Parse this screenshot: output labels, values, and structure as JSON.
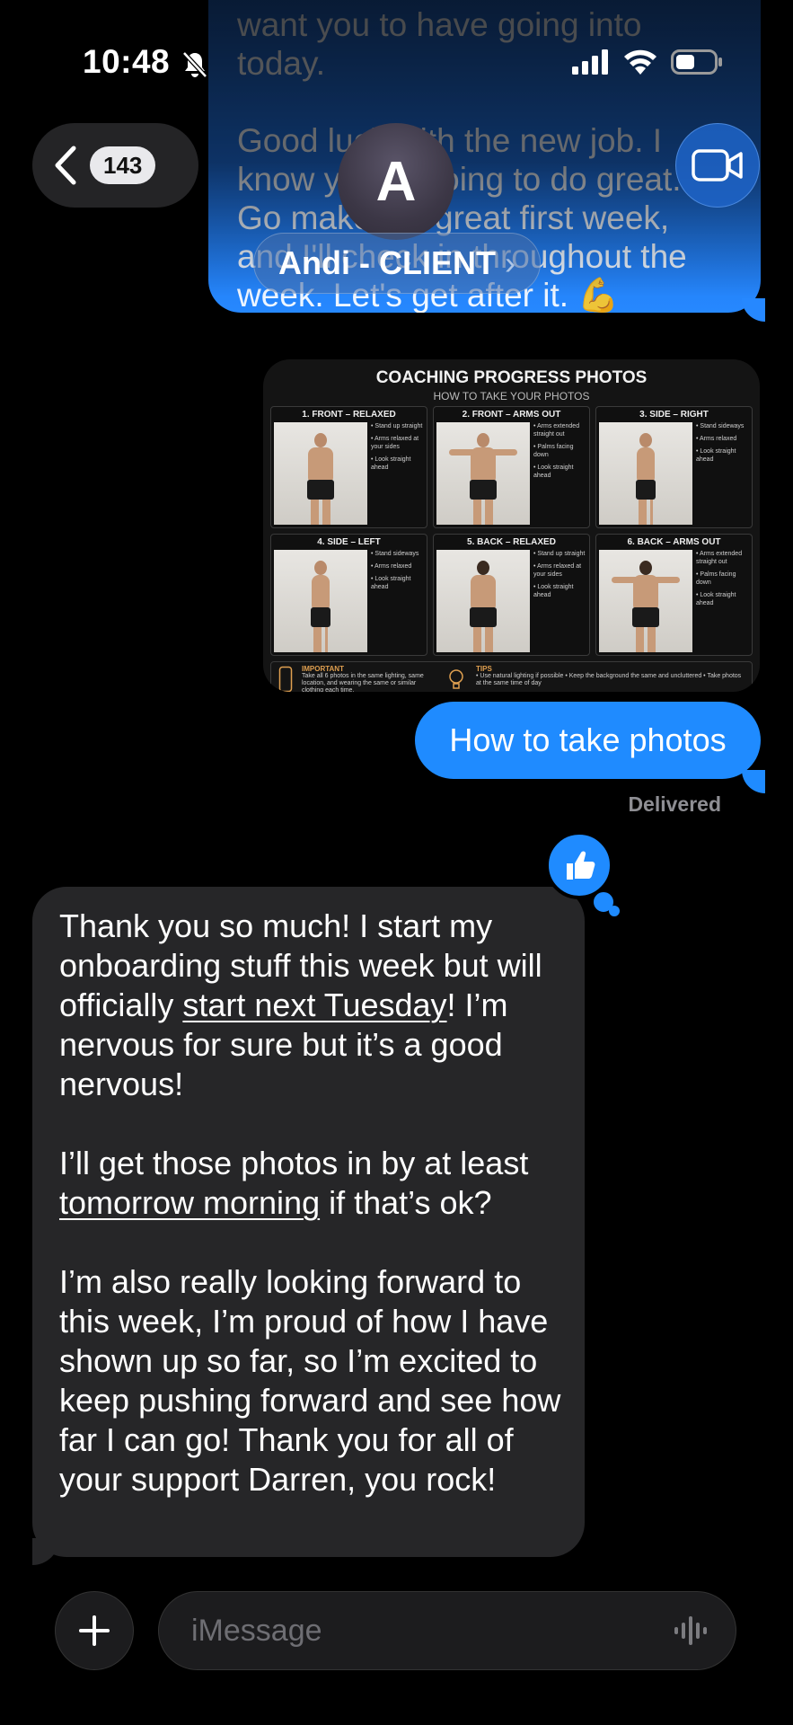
{
  "status_bar": {
    "time": "10:48"
  },
  "header": {
    "back_count": "143",
    "avatar_initial": "A",
    "contact_name": "Andi - CLIENT",
    "contact_chevron": "›"
  },
  "messages": {
    "outgoing_top": {
      "line1": "want you to have going into",
      "line2": "today.",
      "para2": "Good luck with the new job. I know you're going to do great. Go make it a great first week, and I'll check in throughout the week. Let's get after it. 💪"
    },
    "attachment": {
      "title": "COACHING PROGRESS PHOTOS",
      "subtitle": "HOW TO TAKE YOUR PHOTOS",
      "cells": [
        {
          "label": "1. FRONT – RELAXED",
          "notes": [
            "• Stand up straight",
            "• Arms relaxed at your sides",
            "• Look straight ahead"
          ]
        },
        {
          "label": "2. FRONT – ARMS OUT",
          "notes": [
            "• Arms extended straight out",
            "• Palms facing down",
            "• Look straight ahead"
          ]
        },
        {
          "label": "3. SIDE – RIGHT",
          "notes": [
            "• Stand sideways",
            "• Arms relaxed",
            "• Look straight ahead"
          ]
        },
        {
          "label": "4. SIDE – LEFT",
          "notes": [
            "• Stand sideways",
            "• Arms relaxed",
            "• Look straight ahead"
          ]
        },
        {
          "label": "5. BACK – RELAXED",
          "notes": [
            "• Stand up straight",
            "• Arms relaxed at your sides",
            "• Look straight ahead"
          ]
        },
        {
          "label": "6. BACK – ARMS OUT",
          "notes": [
            "• Arms extended straight out",
            "• Palms facing down",
            "• Look straight ahead"
          ]
        }
      ],
      "footer": {
        "important_label": "IMPORTANT",
        "important_text": "Take all 6 photos in the same lighting, same location, and wearing the same or similar clothing each time.",
        "tips_label": "TIPS",
        "tips_text": "• Use natural lighting if possible • Keep the background the same and uncluttered • Take photos at the same time of day"
      }
    },
    "outgoing_short": "How to take photos",
    "delivered": "Delivered",
    "incoming": {
      "p1_a": "Thank you so much! I start my onboarding stuff this week but will officially ",
      "p1_link": "start next Tuesday",
      "p1_b": "! I’m nervous for sure but it’s a good nervous!",
      "p2_a": "I’ll get those photos in by at least ",
      "p2_link": "tomorrow morning",
      "p2_b": " if that’s ok?",
      "p3": "I’m also really looking forward to this week, I’m proud of how I have shown up so far, so I’m excited to keep pushing forward and see how far I can go! Thank you for all of your support Darren, you rock!"
    }
  },
  "input_bar": {
    "placeholder": "iMessage"
  },
  "icons": {
    "back": "chevron-left-icon",
    "video": "video-camera-icon",
    "tapback": "thumbs-up-icon",
    "plus": "plus-icon",
    "audio": "waveform-icon",
    "silent": "bell-slash-icon",
    "signal": "signal-bars-icon",
    "wifi": "wifi-icon",
    "battery": "battery-icon"
  },
  "colors": {
    "outgoing_bubble": "#1f8bff",
    "incoming_bubble": "#262628",
    "background": "#000000",
    "delivered_text": "#8e8e93"
  }
}
